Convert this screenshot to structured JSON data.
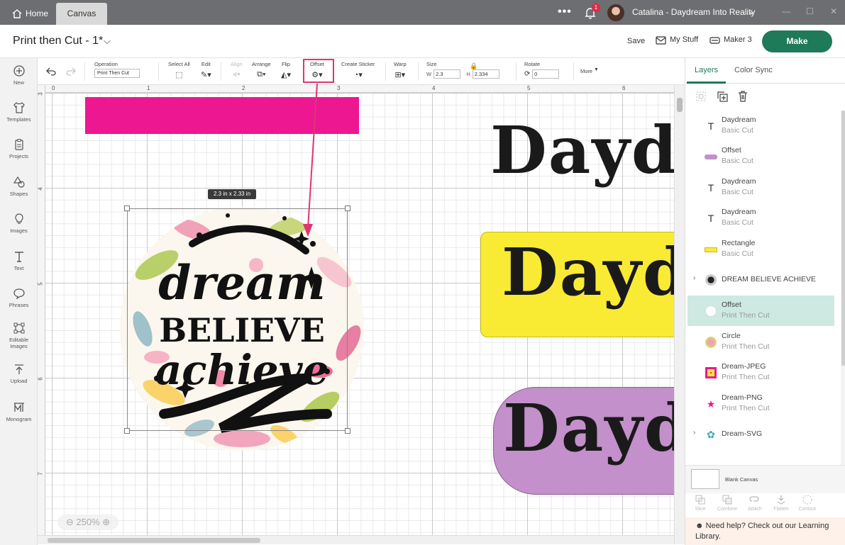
{
  "titlebar": {
    "home_label": "Home",
    "canvas_label": "Canvas",
    "more_label": "•••",
    "notification_count": "1",
    "user_label": "Catalina - Daydream Into Reality",
    "win_minimize": "—",
    "win_maximize": "☐",
    "win_close": "✕"
  },
  "doc": {
    "title": "Print then Cut - 1*",
    "save_label": "Save",
    "mystuff_label": "My Stuff",
    "machine_label": "Maker 3",
    "make_label": "Make"
  },
  "leftnav": {
    "items": [
      {
        "label": "New",
        "icon": "plus-circle-icon"
      },
      {
        "label": "Templates",
        "icon": "shirt-icon"
      },
      {
        "label": "Projects",
        "icon": "projects-icon"
      },
      {
        "label": "Shapes",
        "icon": "shapes-icon"
      },
      {
        "label": "Images",
        "icon": "bulb-icon"
      },
      {
        "label": "Text",
        "icon": "text-icon"
      },
      {
        "label": "Phrases",
        "icon": "speech-icon"
      },
      {
        "label": "Editable Images",
        "icon": "editable-image-icon"
      },
      {
        "label": "Upload",
        "icon": "upload-icon"
      },
      {
        "label": "Monogram",
        "icon": "monogram-icon"
      }
    ]
  },
  "toolbar": {
    "operation_label": "Operation",
    "operation_value": "Print Then Cut",
    "select_all_label": "Select All",
    "edit_label": "Edit",
    "align_label": "Align",
    "arrange_label": "Arrange",
    "flip_label": "Flip",
    "offset_label": "Offset",
    "sticker_label": "Create Sticker",
    "warp_label": "Warp",
    "size_label": "Size",
    "width_label": "W",
    "width_value": "2.3",
    "height_label": "H",
    "height_value": "2.334",
    "rotate_label": "Rotate",
    "rotate_value": "0",
    "more_label": "More"
  },
  "canvas": {
    "ruler_top": [
      "0",
      "1",
      "2",
      "3",
      "4",
      "5",
      "6"
    ],
    "ruler_left": [
      "3",
      "4",
      "5",
      "6",
      "7"
    ],
    "dimension_label": "2.3  in x 2.33  in",
    "design_words": [
      "dream",
      "BELIEVE",
      "achieve"
    ],
    "daydream_text": "Daydre",
    "daydream_text_short": "Daydr",
    "zoom_label": "250%",
    "colors": {
      "pink": "#ec1791",
      "yellow": "#f9ea34",
      "purple": "#c390cb",
      "annotation": "#e0356e"
    }
  },
  "panel": {
    "tab_layers": "Layers",
    "tab_color_sync": "Color Sync",
    "layers": [
      {
        "name": "Daydream",
        "sub": "Basic Cut",
        "thumb": "text-icon"
      },
      {
        "name": "Offset",
        "sub": "Basic Cut",
        "thumb": "offset-purple-thumb"
      },
      {
        "name": "Daydream",
        "sub": "Basic Cut",
        "thumb": "text-icon"
      },
      {
        "name": "Daydream",
        "sub": "Basic Cut",
        "thumb": "text-icon"
      },
      {
        "name": "Rectangle",
        "sub": "Basic Cut",
        "thumb": "yellow-rect-thumb"
      },
      {
        "name": "DREAM BELIEVE ACHIEVE",
        "sub": "",
        "thumb": "group-thumb"
      },
      {
        "name": "Offset",
        "sub": "Print Then Cut",
        "thumb": "offset-white-thumb"
      },
      {
        "name": "Circle",
        "sub": "Print Then Cut",
        "thumb": "circle-floral-thumb"
      },
      {
        "name": "Dream-JPEG",
        "sub": "Print Then Cut",
        "thumb": "jpeg-thumb"
      },
      {
        "name": "Dream-PNG",
        "sub": "Print Then Cut",
        "thumb": "png-thumb"
      },
      {
        "name": "Dream-SVG",
        "sub": "",
        "thumb": "svg-thumb"
      }
    ],
    "blank_canvas_label": "Blank Canvas",
    "bottom_tools": [
      "Slice",
      "Combine",
      "Attach",
      "Flatten",
      "Contour"
    ],
    "help_text": "Need help? Check out our Learning Library."
  }
}
